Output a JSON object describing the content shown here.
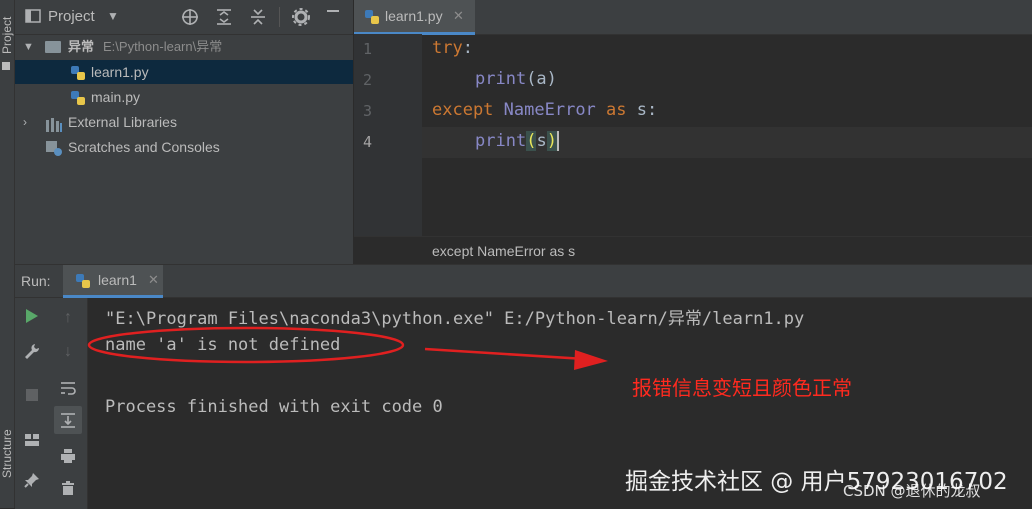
{
  "left_strip": {
    "project_label": "Project",
    "structure_label": "Structure"
  },
  "project": {
    "title": "Project",
    "tree": [
      {
        "label": "异常",
        "path": "E:\\Python-learn\\异常"
      },
      {
        "label": "learn1.py"
      },
      {
        "label": "main.py"
      },
      {
        "label": "External Libraries"
      },
      {
        "label": "Scratches and Consoles"
      }
    ]
  },
  "editor": {
    "tab_label": "learn1.py",
    "line_numbers": [
      "1",
      "2",
      "3",
      "4"
    ],
    "code": {
      "l1_kw": "try",
      "l1_rest": ":",
      "l2_fn": "print",
      "l2_rest": "(a)",
      "l3_kw1": "except",
      "l3_cls": "NameError",
      "l3_kw2": "as",
      "l3_rest": " s:",
      "l4_fn": "print",
      "l4_open": "(",
      "l4_arg": "s",
      "l4_close": ")"
    },
    "breadcrumb": "except NameError as s"
  },
  "run": {
    "label": "Run:",
    "tab_label": "learn1",
    "console": [
      "\"E:\\Program Files\\naconda3\\python.exe\" E:/Python-learn/异常/learn1.py",
      "name 'a' is not defined",
      "",
      "Process finished with exit code 0"
    ]
  },
  "annotation": {
    "text": "报错信息变短且颜色正常",
    "color": "#ff2a1f"
  },
  "watermark": {
    "main": "掘金技术社区 @ 用户57923016702",
    "sub": "CSDN @退休的龙叔"
  },
  "colors": {
    "keyword": "#cc7832",
    "builtin": "#8888c6",
    "text": "#a9b7c6",
    "selection": "#0d293e"
  }
}
